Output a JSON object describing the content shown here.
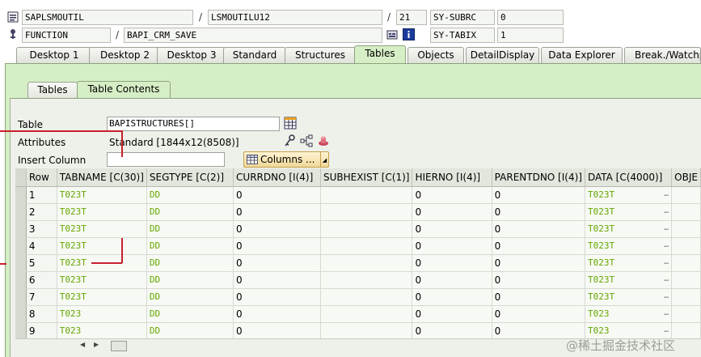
{
  "header": {
    "program": "SAPLSMOUTIL",
    "include": "LSMOUTILU12",
    "line": "21",
    "var1_name": "SY-SUBRC",
    "var1_value": "0",
    "event_type": "FUNCTION",
    "event_name": "BAPI_CRM_SAVE",
    "var2_name": "SY-TABIX",
    "var2_value": "1"
  },
  "tabs": [
    "Desktop 1",
    "Desktop 2",
    "Desktop 3",
    "Standard",
    "Structures",
    "Tables",
    "Objects",
    "DetailDisplay",
    "Data Explorer",
    "Break./Watchpoints"
  ],
  "active_tab": "Tables",
  "inner_tabs": [
    "Tables",
    "Table Contents"
  ],
  "active_inner_tab": "Table Contents",
  "form": {
    "table_label": "Table",
    "table_value": "BAPISTRUCTURES[]",
    "attributes_label": "Attributes",
    "attributes_value": "Standard [1844x12(8508)]",
    "insert_column_label": "Insert Column",
    "insert_column_value": "",
    "columns_button": "Columns ..."
  },
  "grid": {
    "columns": [
      "Row",
      "TABNAME [C(30)]",
      "SEGTYPE [C(2)]",
      "CURRDNO [I(4)]",
      "SUBHEXIST [C(1)]",
      "HIERNO [I(4)]",
      "PARENTDNO [I(4)]",
      "DATA [C(4000)]",
      "OBJE"
    ],
    "rows": [
      {
        "row": "1",
        "tabname": "T023T",
        "segtype": "DD",
        "currdno": "0",
        "subhexist": "",
        "hierno": "0",
        "parentdno": "0",
        "data": "T023T"
      },
      {
        "row": "2",
        "tabname": "T023T",
        "segtype": "DD",
        "currdno": "0",
        "subhexist": "",
        "hierno": "0",
        "parentdno": "0",
        "data": "T023T"
      },
      {
        "row": "3",
        "tabname": "T023T",
        "segtype": "DD",
        "currdno": "0",
        "subhexist": "",
        "hierno": "0",
        "parentdno": "0",
        "data": "T023T"
      },
      {
        "row": "4",
        "tabname": "T023T",
        "segtype": "DD",
        "currdno": "0",
        "subhexist": "",
        "hierno": "0",
        "parentdno": "0",
        "data": "T023T"
      },
      {
        "row": "5",
        "tabname": "T023T",
        "segtype": "DD",
        "currdno": "0",
        "subhexist": "",
        "hierno": "0",
        "parentdno": "0",
        "data": "T023T"
      },
      {
        "row": "6",
        "tabname": "T023T",
        "segtype": "DD",
        "currdno": "0",
        "subhexist": "",
        "hierno": "0",
        "parentdno": "0",
        "data": "T023T"
      },
      {
        "row": "7",
        "tabname": "T023T",
        "segtype": "DD",
        "currdno": "0",
        "subhexist": "",
        "hierno": "0",
        "parentdno": "0",
        "data": "T023T"
      },
      {
        "row": "8",
        "tabname": "T023",
        "segtype": "DD",
        "currdno": "0",
        "subhexist": "",
        "hierno": "0",
        "parentdno": "0",
        "data": "T023"
      },
      {
        "row": "9",
        "tabname": "T023",
        "segtype": "DD",
        "currdno": "0",
        "subhexist": "",
        "hierno": "0",
        "parentdno": "0",
        "data": "T023"
      }
    ]
  },
  "watermark": "@稀土掘金技术社区",
  "colors": {
    "panel": "#d6eec6",
    "value_text": "#64a600",
    "annotation": "#c8202c"
  }
}
